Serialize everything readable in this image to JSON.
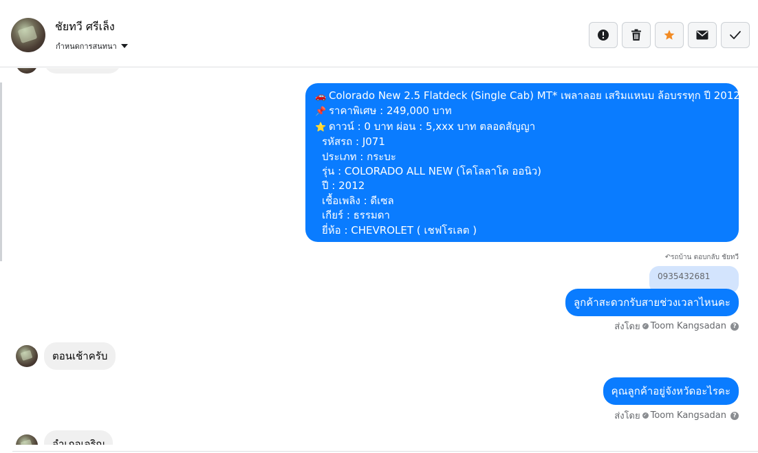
{
  "header": {
    "contact_name": "ชัยทวี ศรีเล็ง",
    "assign_label": "กำหนดการสนทนา",
    "actions": [
      {
        "name": "report-button",
        "icon": "exclamation-icon"
      },
      {
        "name": "delete-button",
        "icon": "trash-icon"
      },
      {
        "name": "star-button",
        "icon": "star-icon"
      },
      {
        "name": "mark-unread-button",
        "icon": "envelope-icon"
      },
      {
        "name": "mark-done-button",
        "icon": "checkmark-icon"
      }
    ]
  },
  "listing": {
    "lines": [
      {
        "emoji": "🚗",
        "text": "Colorado New 2.5 Flatdeck (Single Cab) MT* เพลาลอย เสริมแหนบ ล้อบรรทุก  ปี 2012"
      },
      {
        "emoji": "📌",
        "text": "ราคาพิเศษ : 249,000 บาท"
      },
      {
        "emoji": "⭐",
        "text": "ดาวน์ : 0 บาท ผ่อน : 5,xxx บาท ตลอดสัญญา"
      },
      {
        "emoji": "",
        "text": "รหัสรถ : J071"
      },
      {
        "emoji": "",
        "text": "ประเภท : กระบะ"
      },
      {
        "emoji": "",
        "text": "รุ่น : COLORADO ALL NEW (โคโลลาโด ออนิว)"
      },
      {
        "emoji": "",
        "text": "ปี : 2012"
      },
      {
        "emoji": "",
        "text": "เชื้อเพลิง : ดีเซล"
      },
      {
        "emoji": "",
        "text": "เกียร์ : ธรรมดา"
      },
      {
        "emoji": "",
        "text": "ยี่ห้อ : CHEVROLET ( เชฟโรเลต )"
      }
    ]
  },
  "reply_label": "รถบ้าน ตอบกลับ ชัยทวี",
  "quoted_text": "0935432681",
  "messages": {
    "out_1": "ลูกค้าสะดวกรับสายช่วงเวลาไหนคะ",
    "in_1": "ตอนเช้าครับ",
    "out_2": "คุณลูกค้าอยู่จังหวัดอะไรคะ",
    "in_partial_bottom": "อำเภอเจริญ"
  },
  "sent_by": {
    "prefix": "ส่งโดย",
    "agent": "Toom Kangsadan"
  },
  "colors": {
    "outgoing_bubble": "#0a7cff",
    "incoming_bubble": "#f0f0f0",
    "quoted_bubble": "#d3e4fd",
    "star": "#f28b24"
  }
}
